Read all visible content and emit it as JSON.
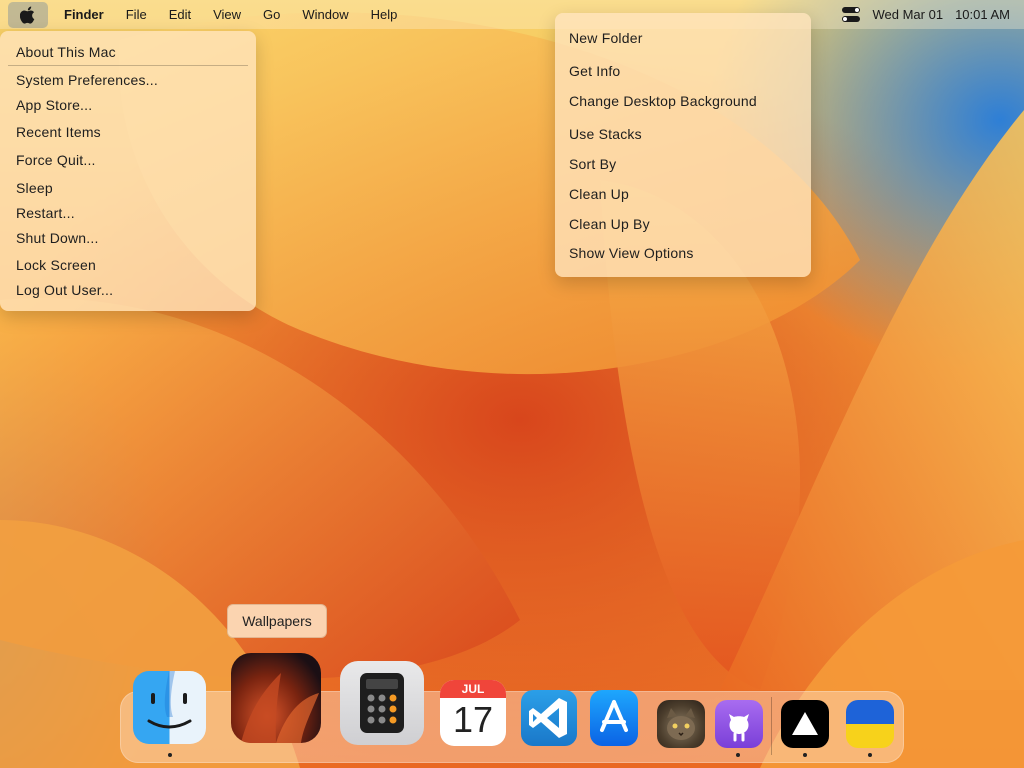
{
  "menubar": {
    "apple_icon": "apple-logo-icon",
    "app_name": "Finder",
    "items": [
      "File",
      "Edit",
      "View",
      "Go",
      "Window",
      "Help"
    ],
    "control_center_icon": "control-center-icon",
    "date": "Wed Mar 01",
    "time": "10:01 AM"
  },
  "apple_menu": {
    "items": [
      "About This Mac",
      "System Preferences...",
      "App Store...",
      "Recent Items",
      "Force Quit...",
      "Sleep",
      "Restart...",
      "Shut Down...",
      "Lock Screen",
      "Log Out User..."
    ]
  },
  "context_menu": {
    "items": [
      "New Folder",
      "Get Info",
      "Change Desktop Background",
      "Use Stacks",
      "Sort By",
      "Clean Up",
      "Clean Up By",
      "Show View Options"
    ]
  },
  "tooltip": {
    "text": "Wallpapers"
  },
  "dock": {
    "apps": [
      {
        "name": "Finder",
        "icon": "finder-icon",
        "running": true
      },
      {
        "name": "Wallpapers",
        "icon": "wallpapers-icon",
        "running": false
      },
      {
        "name": "Calculator",
        "icon": "calculator-icon",
        "running": false
      },
      {
        "name": "Calendar",
        "icon": "calendar-icon",
        "running": false,
        "month": "JUL",
        "day": "17"
      },
      {
        "name": "Visual Studio Code",
        "icon": "vscode-icon",
        "running": false
      },
      {
        "name": "App Store",
        "icon": "app-store-icon",
        "running": false
      },
      {
        "name": "Cat",
        "icon": "cat-icon",
        "running": false
      },
      {
        "name": "GitHub",
        "icon": "github-icon",
        "running": true
      },
      {
        "name": "Vercel",
        "icon": "vercel-icon",
        "running": true
      },
      {
        "name": "Ukraine",
        "icon": "ukraine-flag-icon",
        "running": true
      }
    ]
  },
  "colors": {
    "menu_bg": "#ffe4be",
    "calendar_red": "#f0453a",
    "wallpaper_orange": "#e8742a",
    "wallpaper_blue": "#2e7fd6"
  }
}
